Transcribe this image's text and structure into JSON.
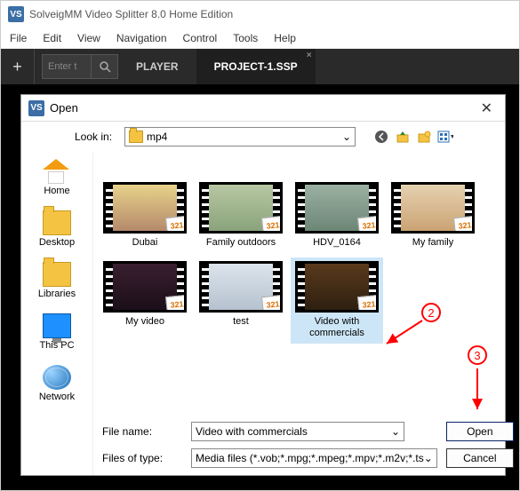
{
  "app": {
    "icon_text": "VS",
    "title": "SolveigMM Video Splitter 8.0 Home Edition"
  },
  "menu": [
    "File",
    "Edit",
    "View",
    "Navigation",
    "Control",
    "Tools",
    "Help"
  ],
  "toolbar": {
    "add_glyph": "+",
    "search_placeholder": "Enter t",
    "tabs": [
      {
        "label": "PLAYER",
        "active": false
      },
      {
        "label": "PROJECT-1.SSP",
        "active": true
      }
    ]
  },
  "dialog": {
    "title": "Open",
    "lookin_label": "Look in:",
    "lookin_value": "mp4",
    "places": [
      {
        "label": "Home",
        "icon": "home-icon"
      },
      {
        "label": "Desktop",
        "icon": "desktop-folder-icon"
      },
      {
        "label": "Libraries",
        "icon": "libraries-folder-icon"
      },
      {
        "label": "This PC",
        "icon": "this-pc-icon"
      },
      {
        "label": "Network",
        "icon": "network-icon"
      }
    ],
    "files": [
      {
        "label": "Dubai",
        "selected": false,
        "imgcls": "a"
      },
      {
        "label": "Family outdoors",
        "selected": false,
        "imgcls": "b"
      },
      {
        "label": "HDV_0164",
        "selected": false,
        "imgcls": "c"
      },
      {
        "label": "My family",
        "selected": false,
        "imgcls": "d"
      },
      {
        "label": "My video",
        "selected": false,
        "imgcls": "e"
      },
      {
        "label": "test",
        "selected": false,
        "imgcls": "f"
      },
      {
        "label": "Video with commercials",
        "selected": true,
        "imgcls": "g"
      }
    ],
    "thumb_badge": "321",
    "filename_label": "File name:",
    "filename_value": "Video with commercials",
    "filetype_label": "Files of type:",
    "filetype_value": "Media files (*.vob;*.mpg;*.mpeg;*.mpv;*.m2v;*.ts",
    "open_label": "Open",
    "cancel_label": "Cancel"
  },
  "annotations": {
    "two": "2",
    "three": "3"
  }
}
